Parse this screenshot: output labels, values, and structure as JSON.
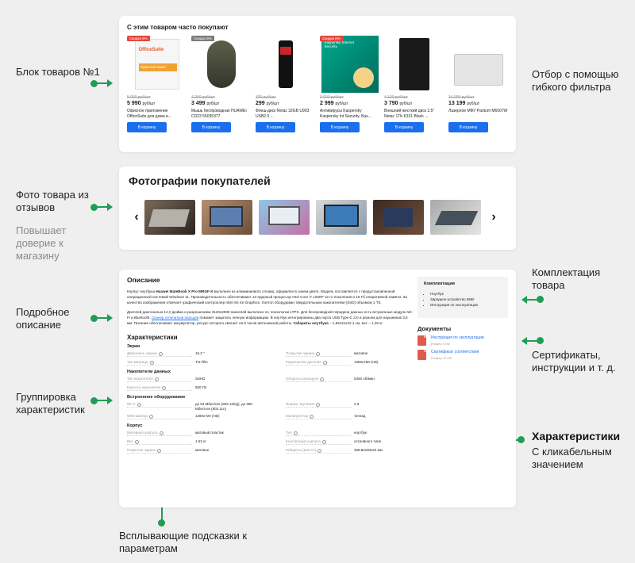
{
  "annotations": {
    "block1": "Блок товаров №1",
    "filter": "Отбор с помощью гибкого фильтра",
    "photos": "Фото товара из отзывов",
    "trust": "Повышает доверие к магазину",
    "kit": "Комплектация товара",
    "description": "Подробное описание",
    "docs": "Сертификаты, инструкции и т. д.",
    "grouping": "Группировка характеристик",
    "specs_title": "Характеристики",
    "specs_sub": "С кликабельным значением",
    "tooltips": "Всплывающие подсказки к параметрам"
  },
  "products_block": {
    "title": "С этим товаром часто покупают",
    "buy_label": "В корзину",
    "items": [
      {
        "badge": "Скидка 5%",
        "old": "5 990 руб/шт",
        "price": "5 990",
        "unit": "руб/шт",
        "name": "Офисное приложение OfficeSuite для дома и...",
        "img_text": "OfficeSuite",
        "img_sub": "Офисный пакет"
      },
      {
        "badge": "Скидка 5%",
        "old": "4 290 руб/шт",
        "price": "3 499",
        "unit": "руб/шт",
        "name": "Мышь беспроводная HUAWEI CD23 55035377"
      },
      {
        "badge": "",
        "old": "320 руб/шт",
        "price": "299",
        "unit": "руб/шт",
        "name": "Флеш-диск Netac 32GB U903 USB2.0 ..."
      },
      {
        "badge": "Скидка 5%",
        "old": "3 690 руб/шт",
        "price": "2 999",
        "unit": "руб/шт",
        "name": "Антивирусы Kaspersky Kaspersky Int Security. Баз...",
        "img_text": "Kaspersky Internet Security"
      },
      {
        "badge": "",
        "old": "4 130 руб/шт",
        "price": "3 790",
        "unit": "руб/шт",
        "name": "Внешний жесткий диск 2.5\" Netac 1Tb K331 Black ..."
      },
      {
        "badge": "",
        "old": "14 200 руб/шт",
        "price": "13 199",
        "unit": "руб/шт",
        "name": "Лазерное МФУ Pantum M6507W"
      }
    ]
  },
  "photos_block": {
    "title": "Фотографии покупателей",
    "prev": "‹",
    "next": "›"
  },
  "desc_block": {
    "title": "Описание",
    "p1_a": "Корпус ноутбука ",
    "p1_b": "Huawei MateBook X Pro MRGF-X",
    "p1_c": " выполнен из алюминиевого сплава, оформлен в синем цвете. Модель поставляется с предустановленной операционной системой Windows 11. Производительность обеспечивают 12-ядерный процессор Intel Core i7 1260P 12-го поколения и 16 Гб оперативной памяти. За качество изображения отвечает графический контроллер Intel Iris Xe Graphics. Лэптоп оборудован твердотельным накопителем (SSD) объемом 1 Тб.",
    "p2_a": "Дисплей диагональю 14,2 дюйма и разрешением 3120x2080 пикселей выполнен по технологии LTPS. Для беспроводной передачи данных есть встроенные модули Wi-Fi и Bluetooth. ",
    "p2_link": "Сканер отпечатков пальцев",
    "p2_b": " поможет защитить личную информацию. В ноутбук интегрированы два порта USB Type-C 3.0 и разъем для наушников 3,5 мм. Питание обеспечивает аккумулятор, ресурс которого хватает на 8 часов автономной работы. ",
    "p2_bold": "Габариты ноутбука",
    "p2_c": " – 1,56x31x22,1 см, вес – 1,26 кг.",
    "kit_title": "Комплектация",
    "kit_items": [
      "Ноутбук",
      "Зарядное устройство 65Вт",
      "Инструкция по эксплуатации"
    ],
    "docs_title": "Документы",
    "docs": [
      {
        "name": "Инструкция по эксплуатации",
        "size": "Размер 9 Мб"
      },
      {
        "name": "Сертификат соответствия",
        "size": "Размер 12 Мб"
      }
    ],
    "specs_title": "Характеристики",
    "groups": [
      {
        "title": "Экран",
        "rows": [
          {
            "k": "Диагональ экрана",
            "v": "15.3 \""
          },
          {
            "k": "Покрытие экрана",
            "v": "матовое"
          },
          {
            "k": "Тип матрицы",
            "v": "TN+film"
          },
          {
            "k": "Разрешение дисплея",
            "v": "1366x768 (HD)"
          }
        ]
      },
      {
        "title": "Накопители данных",
        "rows": [
          {
            "k": "Тип накопителя",
            "v": "SSHD"
          },
          {
            "k": "Обороты шпинделя",
            "v": "5400 об/мин"
          },
          {
            "k": "Емкость накопителя",
            "v": "500 ГБ"
          },
          {
            "k": "",
            "v": ""
          }
        ]
      },
      {
        "title": "Встроенное оборудование",
        "rows": [
          {
            "k": "Wi-Fi",
            "v": "до 54 Мбит/сек (802.11b/g), до 300 Мбит/сек (802.11n)"
          },
          {
            "k": "Формат звучания",
            "v": "2.0"
          },
          {
            "k": "Web-камера",
            "v": "1280x720 (HD)"
          },
          {
            "k": "Манипулятор",
            "v": "тачпад"
          }
        ]
      },
      {
        "title": "Корпус",
        "rows": [
          {
            "k": "Материал корпуса",
            "v": "матовый пластик"
          },
          {
            "k": "Тип",
            "v": "ноутбук"
          },
          {
            "k": "Вес",
            "v": "1.53 кг"
          },
          {
            "k": "Конструкция корпуса",
            "v": "островного типа"
          },
          {
            "k": "Покрытие экрана",
            "v": "матовое"
          },
          {
            "k": "Габариты (ШxГxТ)",
            "v": "338.8x230x22 мм"
          }
        ]
      }
    ]
  },
  "colors": {
    "accent": "#1f9d55",
    "button": "#1a6ef0",
    "badge_red": "#e2463c",
    "badge_gray": "#7a7a7a"
  }
}
